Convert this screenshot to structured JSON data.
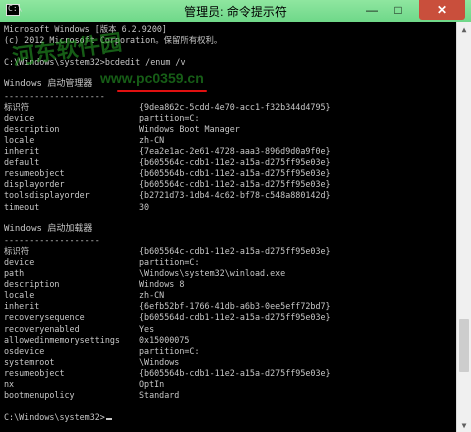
{
  "window": {
    "title": "管理员: 命令提示符",
    "icon_label": "C:\\",
    "controls": {
      "minimize": "—",
      "maximize": "□",
      "close": "✕"
    }
  },
  "watermark": {
    "text": "河东软件园",
    "url": "www.pc0359.cn"
  },
  "console": {
    "header_lines": [
      "Microsoft Windows [版本 6.2.9200]",
      "(c) 2012 Microsoft Corporation。保留所有权利。",
      "",
      "C:\\Windows\\system32>bcdedit /enum /v",
      "",
      "Windows 启动管理器",
      "--------------------"
    ],
    "boot_manager": [
      {
        "key": "标识符",
        "value": "{9dea862c-5cdd-4e70-acc1-f32b344d4795}"
      },
      {
        "key": "device",
        "value": "partition=C:"
      },
      {
        "key": "description",
        "value": "Windows Boot Manager"
      },
      {
        "key": "locale",
        "value": "zh-CN"
      },
      {
        "key": "inherit",
        "value": "{7ea2e1ac-2e61-4728-aaa3-896d9d0a9f0e}"
      },
      {
        "key": "default",
        "value": "{b605564c-cdb1-11e2-a15a-d275ff95e03e}"
      },
      {
        "key": "resumeobject",
        "value": "{b605564b-cdb1-11e2-a15a-d275ff95e03e}"
      },
      {
        "key": "displayorder",
        "value": "{b605564c-cdb1-11e2-a15a-d275ff95e03e}"
      },
      {
        "key": "toolsdisplayorder",
        "value": "{b2721d73-1db4-4c62-bf78-c548a880142d}"
      },
      {
        "key": "timeout",
        "value": "30"
      }
    ],
    "loader_heading": "Windows 启动加载器",
    "loader_rule": "-------------------",
    "boot_loader": [
      {
        "key": "标识符",
        "value": "{b605564c-cdb1-11e2-a15a-d275ff95e03e}"
      },
      {
        "key": "device",
        "value": "partition=C:"
      },
      {
        "key": "path",
        "value": "\\Windows\\system32\\winload.exe"
      },
      {
        "key": "description",
        "value": "Windows 8"
      },
      {
        "key": "locale",
        "value": "zh-CN"
      },
      {
        "key": "inherit",
        "value": "{6efb52bf-1766-41db-a6b3-0ee5eff72bd7}"
      },
      {
        "key": "recoverysequence",
        "value": "{b605564d-cdb1-11e2-a15a-d275ff95e03e}"
      },
      {
        "key": "recoveryenabled",
        "value": "Yes"
      },
      {
        "key": "allowedinmemorysettings",
        "value": "0x15000075"
      },
      {
        "key": "osdevice",
        "value": "partition=C:"
      },
      {
        "key": "systemroot",
        "value": "\\Windows"
      },
      {
        "key": "resumeobject",
        "value": "{b605564b-cdb1-11e2-a15a-d275ff95e03e}"
      },
      {
        "key": "nx",
        "value": "OptIn"
      },
      {
        "key": "bootmenupolicy",
        "value": "Standard"
      }
    ],
    "prompt": "C:\\Windows\\system32>",
    "highlight_color": "#e01010"
  },
  "scrollbar": {
    "up": "▲",
    "down": "▼",
    "position": 0.86,
    "visible_fraction": 0.14
  }
}
